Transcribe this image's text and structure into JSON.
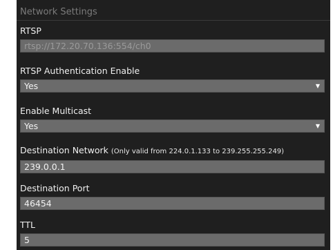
{
  "section": {
    "title": "Network Settings"
  },
  "fields": {
    "rtsp": {
      "label": "RTSP",
      "placeholder": "rtsp://172.20.70.136:554/ch0"
    },
    "rtsp_auth": {
      "label": "RTSP Authentication Enable",
      "value": "Yes",
      "options": [
        "Yes"
      ]
    },
    "multicast": {
      "label": "Enable Multicast",
      "value": "Yes",
      "options": [
        "Yes"
      ]
    },
    "dest_network": {
      "label": "Destination Network",
      "note": "(Only valid from 224.0.1.133 to 239.255.255.249)",
      "value": "239.0.0.1"
    },
    "dest_port": {
      "label": "Destination Port",
      "value": "46454"
    },
    "ttl": {
      "label": "TTL",
      "value": "5"
    }
  },
  "icons": {
    "dropdown": "chevron-down-icon",
    "dropdown_glyph": "▼"
  }
}
